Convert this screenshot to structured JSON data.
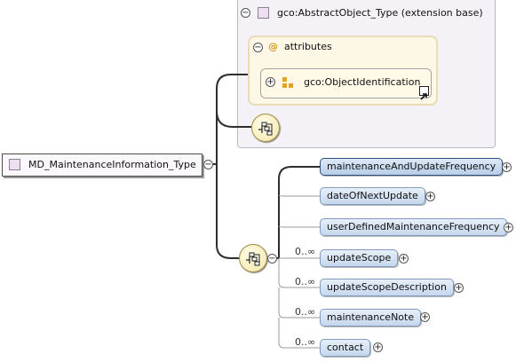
{
  "extension": {
    "label": "gco:AbstractObject_Type (extension base)",
    "attributes_label": "attributes",
    "attributes_icon": "@",
    "group_ref": "gco:ObjectIdentification"
  },
  "root": {
    "label": "MD_MaintenanceInformation_Type"
  },
  "elements": [
    {
      "label": "maintenanceAndUpdateFrequency",
      "cardinality": "",
      "selected": true
    },
    {
      "label": "dateOfNextUpdate",
      "cardinality": ""
    },
    {
      "label": "userDefinedMaintenanceFrequency",
      "cardinality": ""
    },
    {
      "label": "updateScope",
      "cardinality": "0..∞"
    },
    {
      "label": "updateScopeDescription",
      "cardinality": "0..∞"
    },
    {
      "label": "maintenanceNote",
      "cardinality": "0..∞"
    },
    {
      "label": "contact",
      "cardinality": "0..∞"
    }
  ],
  "symbols": {
    "collapse": "−",
    "expand": "+"
  }
}
